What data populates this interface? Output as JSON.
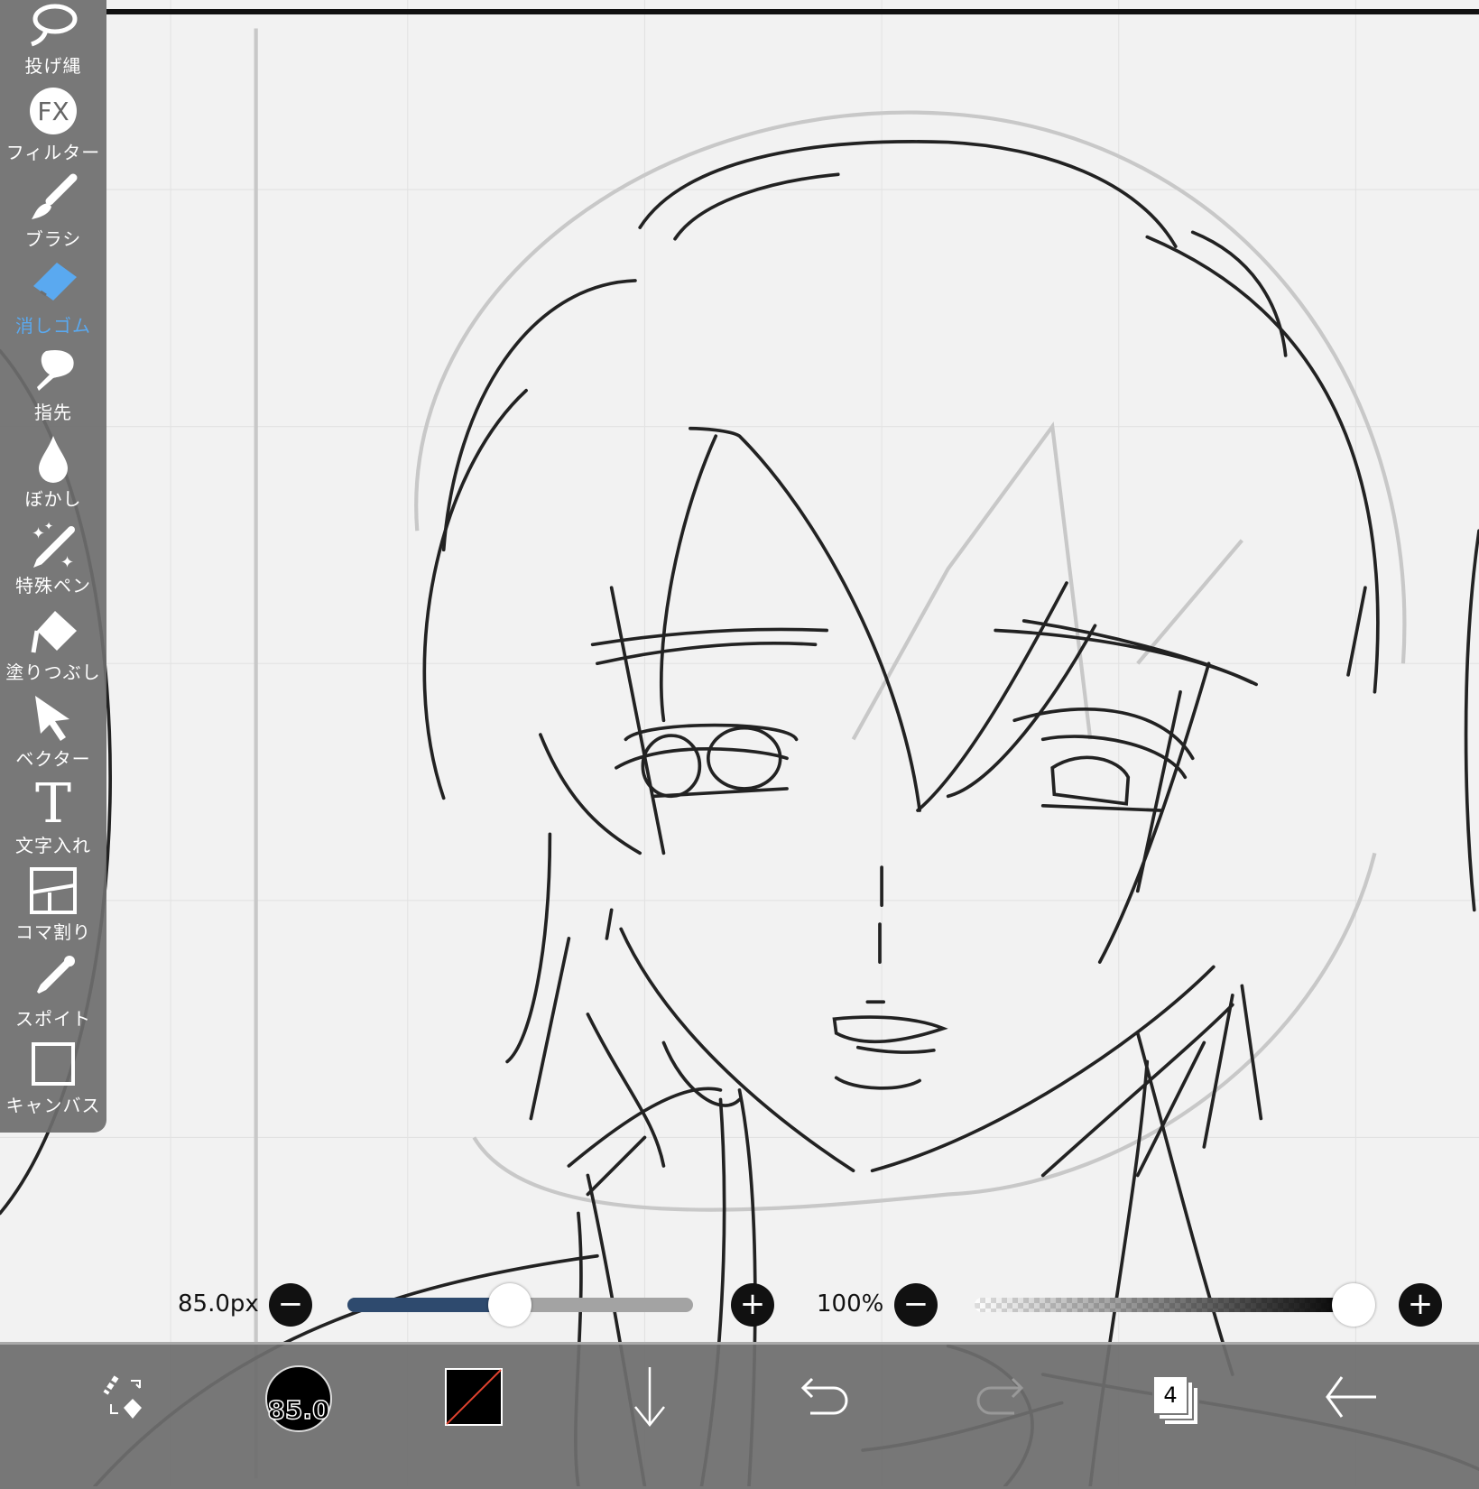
{
  "toolbar": {
    "active_color": "#5aa9f0",
    "tools": [
      {
        "label": "投げ縄",
        "icon": "lasso-icon"
      },
      {
        "label": "フィルター",
        "icon": "fx-icon",
        "glyph": "FX"
      },
      {
        "label": "ブラシ",
        "icon": "brush-icon"
      },
      {
        "label": "消しゴム",
        "icon": "eraser-icon",
        "active": true
      },
      {
        "label": "指先",
        "icon": "finger-icon"
      },
      {
        "label": "ぼかし",
        "icon": "blur-drop-icon"
      },
      {
        "label": "特殊ペン",
        "icon": "special-pen-icon"
      },
      {
        "label": "塗りつぶし",
        "icon": "fill-icon"
      },
      {
        "label": "ベクター",
        "icon": "vector-arrow-icon"
      },
      {
        "label": "文字入れ",
        "icon": "text-icon",
        "glyph": "T"
      },
      {
        "label": "コマ割り",
        "icon": "frame-divider-icon"
      },
      {
        "label": "スポイト",
        "icon": "eyedropper-icon"
      },
      {
        "label": "キャンバス",
        "icon": "canvas-icon"
      }
    ]
  },
  "sliders": {
    "size_label": "85.0px",
    "size_fraction": 0.47,
    "opacity_label": "100%",
    "opacity_fraction": 1.0,
    "minus": "−",
    "plus": "+",
    "size_fill_color": "#2e4a6e"
  },
  "bottombar": {
    "brush_size_badge": "85.0",
    "layer_count": "4",
    "items": [
      "swap-tool-icon",
      "brush-size-icon",
      "color-swatch-icon",
      "download-arrow-icon",
      "undo-icon",
      "redo-icon",
      "layers-icon",
      "back-arrow-icon"
    ]
  }
}
